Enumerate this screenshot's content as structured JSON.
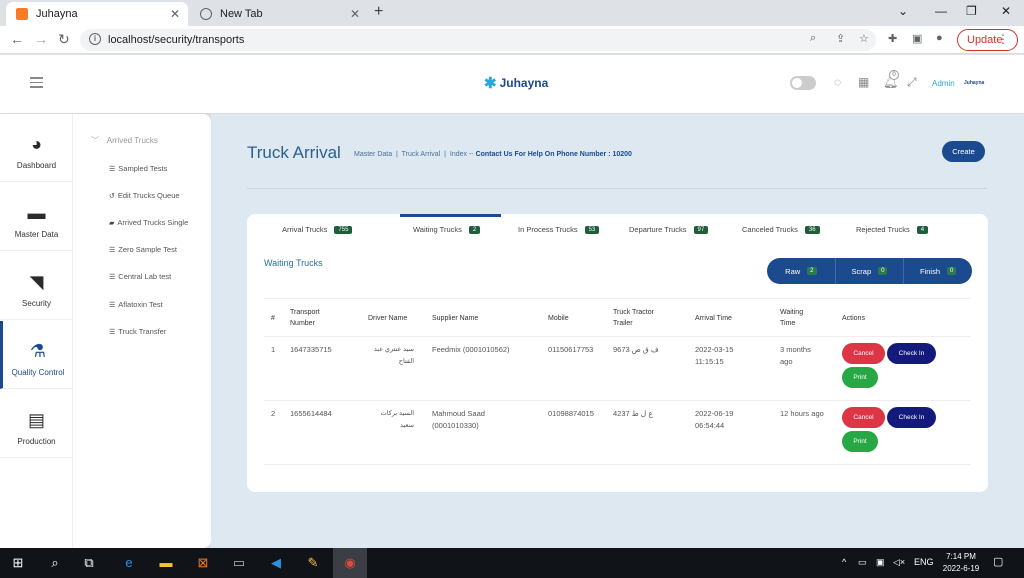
{
  "browser": {
    "tabs": [
      {
        "title": "Juhayna",
        "active": true
      },
      {
        "title": "New Tab",
        "active": false
      }
    ],
    "url": "localhost/security/transports",
    "update_label": "Update"
  },
  "header": {
    "logo_text": "Juhayna",
    "user": "Admin",
    "notifications": "0",
    "mini_logo": "Juhayna"
  },
  "sidebar": {
    "items": [
      {
        "label": "Dashboard",
        "icon": "pie-chart-icon"
      },
      {
        "label": "Master Data",
        "icon": "folder-icon"
      },
      {
        "label": "Security",
        "icon": "cctv-camera-icon"
      },
      {
        "label": "Quality Control",
        "icon": "flask-icon",
        "active": true
      },
      {
        "label": "Production",
        "icon": "conveyor-icon"
      }
    ]
  },
  "submenu": {
    "header": "Arrived Trucks",
    "items": [
      {
        "label": "Sampled Tests"
      },
      {
        "label": "Edit Trucks Queue"
      },
      {
        "label": "Arrived Trucks Single"
      },
      {
        "label": "Zero Sample Test"
      },
      {
        "label": "Central Lab test"
      },
      {
        "label": "Aflatoxin Test"
      },
      {
        "label": "Truck Transfer"
      }
    ]
  },
  "page": {
    "title": "Truck Arrival",
    "crumb1": "Master Data",
    "crumb2": "Truck Arrival",
    "crumb3": "Index --",
    "help": "Contact Us For Help On Phone Number : 10200",
    "create_label": "Create"
  },
  "tabs": [
    {
      "label": "Arrival Trucks",
      "count": "755"
    },
    {
      "label": "Waiting Trucks",
      "count": "2",
      "active": true
    },
    {
      "label": "In Process Trucks",
      "count": "53"
    },
    {
      "label": "Departure Trucks",
      "count": "97"
    },
    {
      "label": "Canceled Trucks",
      "count": "36"
    },
    {
      "label": "Rejected Trucks",
      "count": "4"
    }
  ],
  "section_title": "Waiting Trucks",
  "status_filters": [
    {
      "label": "Raw",
      "count": "2"
    },
    {
      "label": "Scrap",
      "count": "0"
    },
    {
      "label": "Finish",
      "count": "0"
    }
  ],
  "table": {
    "headers": [
      "#",
      "Transport Number",
      "Driver Name",
      "Supplier Name",
      "Mobile",
      "Truck Tractor Trailer",
      "Arrival Time",
      "Waiting Time",
      "Actions"
    ],
    "rows": [
      {
        "idx": "1",
        "transport": "1647335715",
        "driver": "سيد عنتري عبد الفتاح",
        "supplier": "Feedmix (0001010562)",
        "mobile": "01150617753",
        "trailer": "ف ق ص 9673",
        "arrival": "2022-03-15 11:15:15",
        "waiting": "3 months ago"
      },
      {
        "idx": "2",
        "transport": "1655614484",
        "driver": "السيد بركات سعيد",
        "supplier": "Mahmoud Saad (0001010330)",
        "mobile": "01098874015",
        "trailer": "ع ل ط 4237",
        "arrival": "2022-06-19 06:54:44",
        "waiting": "12 hours ago"
      }
    ],
    "actions": {
      "cancel": "Cancel",
      "checkin": "Check In",
      "print": "Print"
    }
  },
  "taskbar": {
    "lang": "ENG",
    "time": "7:14 PM",
    "date": "2022-6-19"
  }
}
